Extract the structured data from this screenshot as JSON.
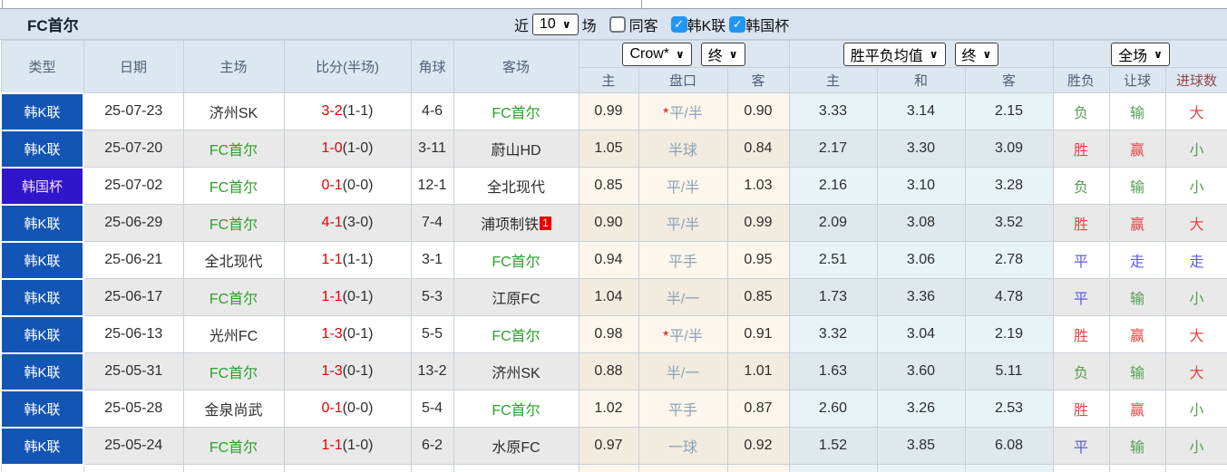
{
  "title": "FC首尔",
  "icons": {
    "chevron": "∨",
    "check": "✓",
    "star": "*"
  },
  "colors": {
    "kleague_badge": "#1355b4",
    "cup_badge": "#2f16cd",
    "self_team_green": "#2ba02b",
    "score_red": "#e60000",
    "win_red": "#e84545",
    "loss_green": "#55a055",
    "draw_blue": "#5b5be0",
    "checkbox_blue": "#2196f3",
    "titlebar_bg": "#d9e4f0",
    "header_bg": "#dde7f1"
  },
  "topbar": {
    "recent_label": "近",
    "recent_value": "10",
    "games_label": "场",
    "same_venue_label": "同客",
    "kleague_label": "韩K联",
    "cup_label": "韩国杯"
  },
  "header": {
    "col_type": "类型",
    "col_date": "日期",
    "col_home": "主场",
    "col_score": "比分(半场)",
    "col_corner": "角球",
    "col_away": "客场",
    "odds_source_select": "Crow*",
    "odds_final_select": "终",
    "mean_select": "胜平负均值",
    "mean_final_select": "终",
    "scope_select": "全场",
    "sub": {
      "home": "主",
      "handicap": "盘口",
      "away": "客",
      "mean_home": "主",
      "mean_draw": "和",
      "mean_away": "客",
      "win_loss": "胜负",
      "handicap_result": "让球",
      "goals": "进球数"
    }
  },
  "rows": [
    {
      "league": "韩K联",
      "league_type": "kleague",
      "date": "25-07-23",
      "home": "济州SK",
      "home_self": false,
      "score_main": "3-2",
      "score_half": "(1-1)",
      "corner": "4-6",
      "away": "FC首尔",
      "away_self": true,
      "odds_home": "0.99",
      "handicap_star": true,
      "handicap": "平/半",
      "odds_away": "0.90",
      "mean_home": "3.33",
      "mean_draw": "3.14",
      "mean_away": "2.15",
      "result_wl": "负",
      "result_wl_color": "green",
      "result_handicap": "输",
      "result_handicap_color": "green",
      "result_goals": "大",
      "result_goals_color": "red"
    },
    {
      "league": "韩K联",
      "league_type": "kleague",
      "date": "25-07-20",
      "home": "FC首尔",
      "home_self": true,
      "score_main": "1-0",
      "score_half": "(1-0)",
      "corner": "3-11",
      "away": "蔚山HD",
      "away_self": false,
      "odds_home": "1.05",
      "handicap_star": false,
      "handicap": "半球",
      "odds_away": "0.84",
      "mean_home": "2.17",
      "mean_draw": "3.30",
      "mean_away": "3.09",
      "result_wl": "胜",
      "result_wl_color": "red",
      "result_handicap": "赢",
      "result_handicap_color": "red",
      "result_goals": "小",
      "result_goals_color": "green"
    },
    {
      "league": "韩国杯",
      "league_type": "cup",
      "date": "25-07-02",
      "home": "FC首尔",
      "home_self": true,
      "score_main": "0-1",
      "score_half": "(0-0)",
      "corner": "12-1",
      "away": "全北现代",
      "away_self": false,
      "odds_home": "0.85",
      "handicap_star": false,
      "handicap": "平/半",
      "odds_away": "1.03",
      "mean_home": "2.16",
      "mean_draw": "3.10",
      "mean_away": "3.28",
      "result_wl": "负",
      "result_wl_color": "green",
      "result_handicap": "输",
      "result_handicap_color": "green",
      "result_goals": "小",
      "result_goals_color": "green"
    },
    {
      "league": "韩K联",
      "league_type": "kleague",
      "date": "25-06-29",
      "home": "FC首尔",
      "home_self": true,
      "score_main": "4-1",
      "score_half": "(3-0)",
      "corner": "7-4",
      "away": "浦项制铁",
      "away_self": false,
      "away_badge": "1",
      "odds_home": "0.90",
      "handicap_star": false,
      "handicap": "平/半",
      "odds_away": "0.99",
      "mean_home": "2.09",
      "mean_draw": "3.08",
      "mean_away": "3.52",
      "result_wl": "胜",
      "result_wl_color": "red",
      "result_handicap": "赢",
      "result_handicap_color": "red",
      "result_goals": "大",
      "result_goals_color": "red"
    },
    {
      "league": "韩K联",
      "league_type": "kleague",
      "date": "25-06-21",
      "home": "全北现代",
      "home_self": false,
      "score_main": "1-1",
      "score_half": "(1-1)",
      "corner": "3-1",
      "away": "FC首尔",
      "away_self": true,
      "odds_home": "0.94",
      "handicap_star": false,
      "handicap": "平手",
      "odds_away": "0.95",
      "mean_home": "2.51",
      "mean_draw": "3.06",
      "mean_away": "2.78",
      "result_wl": "平",
      "result_wl_color": "blue",
      "result_handicap": "走",
      "result_handicap_color": "blue",
      "result_goals": "走",
      "result_goals_color": "blue"
    },
    {
      "league": "韩K联",
      "league_type": "kleague",
      "date": "25-06-17",
      "home": "FC首尔",
      "home_self": true,
      "score_main": "1-1",
      "score_half": "(0-1)",
      "corner": "5-3",
      "away": "江原FC",
      "away_self": false,
      "odds_home": "1.04",
      "handicap_star": false,
      "handicap": "半/一",
      "odds_away": "0.85",
      "mean_home": "1.73",
      "mean_draw": "3.36",
      "mean_away": "4.78",
      "result_wl": "平",
      "result_wl_color": "blue",
      "result_handicap": "输",
      "result_handicap_color": "green",
      "result_goals": "小",
      "result_goals_color": "green"
    },
    {
      "league": "韩K联",
      "league_type": "kleague",
      "date": "25-06-13",
      "home": "光州FC",
      "home_self": false,
      "score_main": "1-3",
      "score_half": "(0-1)",
      "corner": "5-5",
      "away": "FC首尔",
      "away_self": true,
      "odds_home": "0.98",
      "handicap_star": true,
      "handicap": "平/半",
      "odds_away": "0.91",
      "mean_home": "3.32",
      "mean_draw": "3.04",
      "mean_away": "2.19",
      "result_wl": "胜",
      "result_wl_color": "red",
      "result_handicap": "赢",
      "result_handicap_color": "red",
      "result_goals": "大",
      "result_goals_color": "red"
    },
    {
      "league": "韩K联",
      "league_type": "kleague",
      "date": "25-05-31",
      "home": "FC首尔",
      "home_self": true,
      "score_main": "1-3",
      "score_half": "(0-1)",
      "corner": "13-2",
      "away": "济州SK",
      "away_self": false,
      "odds_home": "0.88",
      "handicap_star": false,
      "handicap": "半/一",
      "odds_away": "1.01",
      "mean_home": "1.63",
      "mean_draw": "3.60",
      "mean_away": "5.11",
      "result_wl": "负",
      "result_wl_color": "green",
      "result_handicap": "输",
      "result_handicap_color": "green",
      "result_goals": "大",
      "result_goals_color": "red"
    },
    {
      "league": "韩K联",
      "league_type": "kleague",
      "date": "25-05-28",
      "home": "金泉尚武",
      "home_self": false,
      "score_main": "0-1",
      "score_half": "(0-0)",
      "corner": "5-4",
      "away": "FC首尔",
      "away_self": true,
      "odds_home": "1.02",
      "handicap_star": false,
      "handicap": "平手",
      "odds_away": "0.87",
      "mean_home": "2.60",
      "mean_draw": "3.26",
      "mean_away": "2.53",
      "result_wl": "胜",
      "result_wl_color": "red",
      "result_handicap": "赢",
      "result_handicap_color": "red",
      "result_goals": "小",
      "result_goals_color": "green"
    },
    {
      "league": "韩K联",
      "league_type": "kleague",
      "date": "25-05-24",
      "home": "FC首尔",
      "home_self": true,
      "score_main": "1-1",
      "score_half": "(1-0)",
      "corner": "6-2",
      "away": "水原FC",
      "away_self": false,
      "odds_home": "0.97",
      "handicap_star": false,
      "handicap": "一球",
      "odds_away": "0.92",
      "mean_home": "1.52",
      "mean_draw": "3.85",
      "mean_away": "6.08",
      "result_wl": "平",
      "result_wl_color": "blue",
      "result_handicap": "输",
      "result_handicap_color": "green",
      "result_goals": "小",
      "result_goals_color": "green"
    }
  ]
}
